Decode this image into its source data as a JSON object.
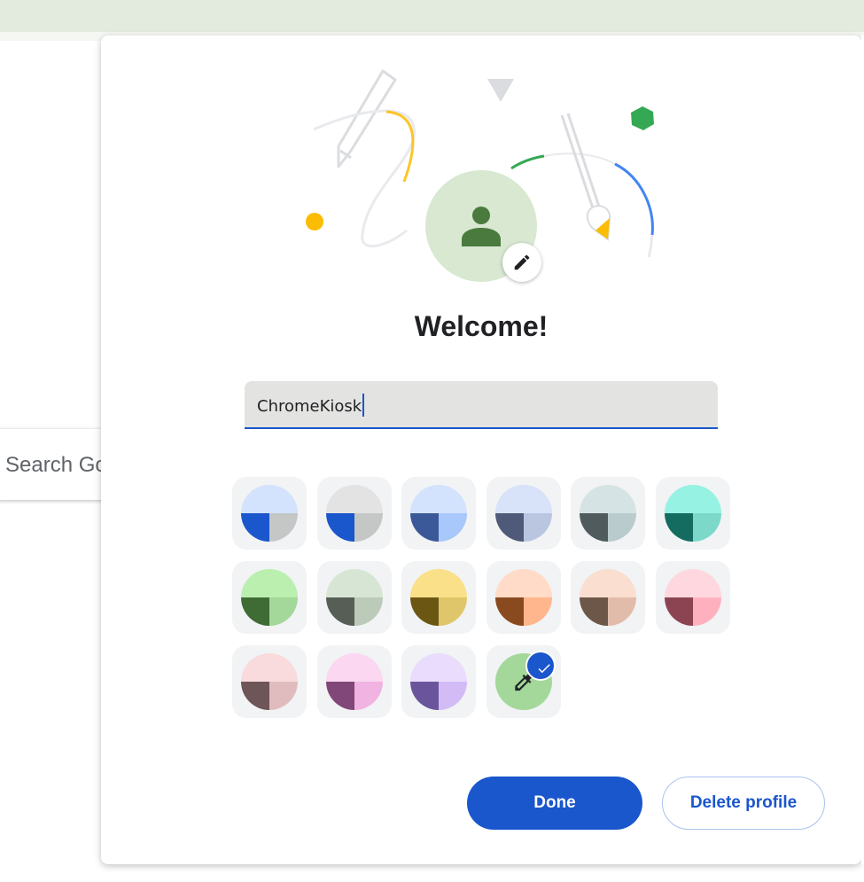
{
  "background": {
    "search_text": "Search Go"
  },
  "dialog": {
    "title": "Welcome!",
    "name_value": "ChromeKiosk",
    "done_label": "Done",
    "delete_label": "Delete profile",
    "accent_color": "#1a56cc",
    "avatar_color": "#d8e8d1",
    "avatar_icon": "person-icon",
    "edit_icon": "pencil-icon"
  },
  "themes": [
    {
      "id": "theme-1",
      "top": "#d3e3fd",
      "bl": "#1a56cc",
      "br": "#c4c7c5"
    },
    {
      "id": "theme-2",
      "top": "#e3e3e3",
      "bl": "#1a56cc",
      "br": "#c4c7c5"
    },
    {
      "id": "theme-3",
      "top": "#d3e3fd",
      "bl": "#3b5998",
      "br": "#a8c7fa"
    },
    {
      "id": "theme-4",
      "top": "#d8e2f8",
      "bl": "#4e5a77",
      "br": "#bac6e0"
    },
    {
      "id": "theme-5",
      "top": "#d5e3e4",
      "bl": "#4f5b5d",
      "br": "#bacbcd"
    },
    {
      "id": "theme-6",
      "top": "#96f2e2",
      "bl": "#146b60",
      "br": "#7cd9c9"
    },
    {
      "id": "theme-7",
      "top": "#baefb0",
      "bl": "#3f6b35",
      "br": "#a3d89a"
    },
    {
      "id": "theme-8",
      "top": "#d7e6d4",
      "bl": "#565e55",
      "br": "#bccbb9"
    },
    {
      "id": "theme-9",
      "top": "#fbe08a",
      "bl": "#6b5713",
      "br": "#e0c66a"
    },
    {
      "id": "theme-10",
      "top": "#ffdbc8",
      "bl": "#8a4a1f",
      "br": "#ffb68c"
    },
    {
      "id": "theme-11",
      "top": "#fadecf",
      "bl": "#6d5749",
      "br": "#e2bcaa"
    },
    {
      "id": "theme-12",
      "top": "#ffd8df",
      "bl": "#8c4453",
      "br": "#ffb0bf"
    },
    {
      "id": "theme-13",
      "top": "#f9dbde",
      "bl": "#6e5557",
      "br": "#e0bcbf"
    },
    {
      "id": "theme-14",
      "top": "#fbd7f2",
      "bl": "#804778",
      "br": "#f1b3e2"
    },
    {
      "id": "theme-15",
      "top": "#eadcfd",
      "bl": "#6a559d",
      "br": "#d3bbf6"
    },
    {
      "id": "theme-custom",
      "custom": true,
      "color": "#a3d89a",
      "icon": "eyedropper-icon",
      "selected": true
    }
  ]
}
